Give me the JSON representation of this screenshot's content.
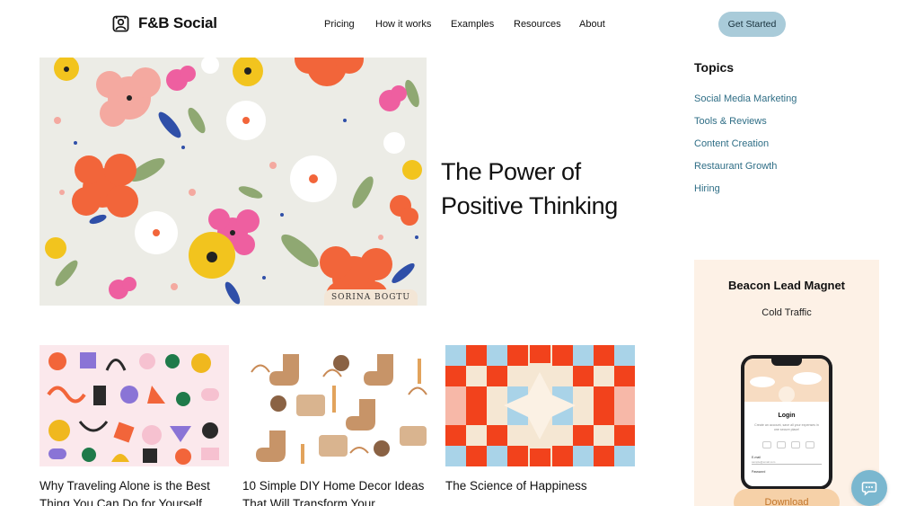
{
  "brand": {
    "name": "F&B Social",
    "logo_icon": "person-frame-icon"
  },
  "nav": {
    "items": [
      "Pricing",
      "How it works",
      "Examples",
      "Resources",
      "About"
    ],
    "cta_label": "Get Started",
    "cta_color": "#a9cbd9"
  },
  "hero": {
    "title": "The Power of Positive Thinking",
    "image_signature": "SORINA BOGTU"
  },
  "cards": [
    {
      "title": "Why Traveling Alone is the Best Thing You Can Do for Yourself"
    },
    {
      "title": "10 Simple DIY Home Decor Ideas That Will Transform Your"
    },
    {
      "title": "The Science of Happiness"
    }
  ],
  "sidebar": {
    "topics_heading": "Topics",
    "topics": [
      "Social Media Marketing",
      "Tools & Reviews",
      "Content Creation",
      "Restaurant Growth",
      "Hiring"
    ],
    "link_color": "#2f6e86"
  },
  "lead_magnet": {
    "title": "Beacon Lead Magnet",
    "subtitle": "Cold Traffic",
    "phone": {
      "heading": "Login",
      "text": "Create an account, save all your expenses in one secure place!",
      "email_label": "E-mail",
      "email_value": "sample@email.com",
      "password_label": "Password"
    },
    "button_label": "Download",
    "background": "#fdf1e6"
  },
  "chat": {
    "icon": "chat-bubble-icon",
    "color": "#7ab7cf"
  }
}
